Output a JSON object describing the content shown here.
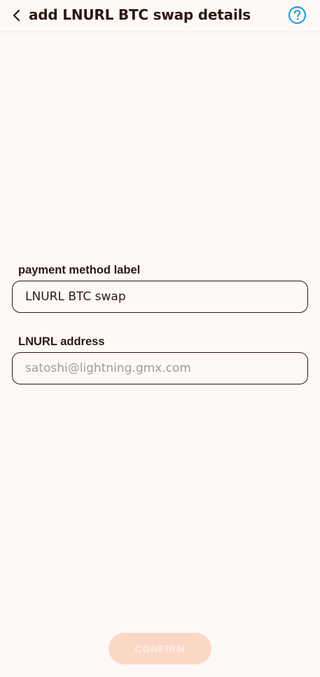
{
  "header": {
    "title": "add LNURL BTC swap details",
    "back_icon": "chevron-left-icon",
    "help_icon": "question-circle-icon"
  },
  "form": {
    "label_field": {
      "label": "payment method label",
      "value": "LNURL BTC swap",
      "placeholder": ""
    },
    "address_field": {
      "label": "LNURL address",
      "value": "",
      "placeholder": "satoshi@lightning.gmx.com"
    }
  },
  "footer": {
    "confirm_label": "CONFIRM",
    "confirm_enabled": false
  },
  "colors": {
    "background": "#FEF9F6",
    "text": "#2B1911",
    "accent_help": "#2A9FD8",
    "confirm_disabled_bg": "#FBD8C5",
    "confirm_disabled_text": "#FDEDE4"
  }
}
